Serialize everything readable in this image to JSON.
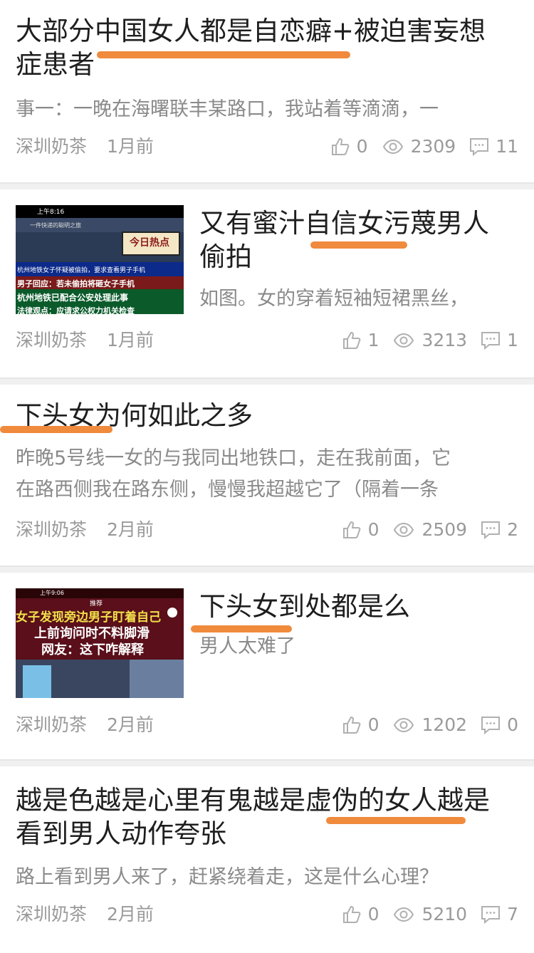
{
  "posts": [
    {
      "title_line1": "大部分中国女人都是自恋癖+被迫害妄想",
      "title_line2": "症患者",
      "excerpt": "事一：一晚在海曙联丰某路口，我站着等滴滴，一",
      "author": "深圳奶茶",
      "time": "1月前",
      "likes": "0",
      "views": "2309",
      "comments": "11"
    },
    {
      "title_line1": "又有蜜汁自信女污蔑男人",
      "title_line2": "偷拍",
      "excerpt": "如图。女的穿着短袖短裙黑丝，",
      "author": "深圳奶茶",
      "time": "1月前",
      "likes": "1",
      "views": "3213",
      "comments": "1",
      "thumb": {
        "status_time": "上午8:16",
        "top_caption": "一件快递的聪明之旅",
        "badge": "今日热点",
        "caption1": "杭州地铁女子怀疑被偷拍，要求查看男子手机",
        "caption2": "男子回应：若未偷拍将砸女子手机",
        "caption3": "杭州地铁已配合公安处理此事",
        "caption4": "法律观点：应请求公权力机关检查"
      }
    },
    {
      "title_line1": "下头女为何如此之多",
      "excerpt_line1": "昨晚5号线一女的与我同出地铁口，走在我前面，它",
      "excerpt_line2": "在路西侧我在路东侧，慢慢我超越它了（隔着一条",
      "author": "深圳奶茶",
      "time": "2月前",
      "likes": "0",
      "views": "2509",
      "comments": "2"
    },
    {
      "title_line1": "下头女到处都是么",
      "excerpt": "男人太难了",
      "author": "深圳奶茶",
      "time": "2月前",
      "likes": "0",
      "views": "1202",
      "comments": "0",
      "thumb": {
        "status_time": "上午9:06",
        "tag": "推荐",
        "caption1": "女子发现旁边男子盯着自己",
        "caption2": "上前询问时不料脚滑",
        "caption3": "网友：这下咋解释"
      }
    },
    {
      "title_line1": "越是色越是心里有鬼越是虚伪的女人越是",
      "title_line2": "看到男人动作夸张",
      "excerpt": "路上看到男人来了，赶紧绕着走，这是什么心理？",
      "author": "深圳奶茶",
      "time": "2月前",
      "likes": "0",
      "views": "5210",
      "comments": "7"
    }
  ],
  "colors": {
    "underline": "#f08a3c",
    "meta": "#9a9a9a",
    "title": "#1e1e1e"
  }
}
